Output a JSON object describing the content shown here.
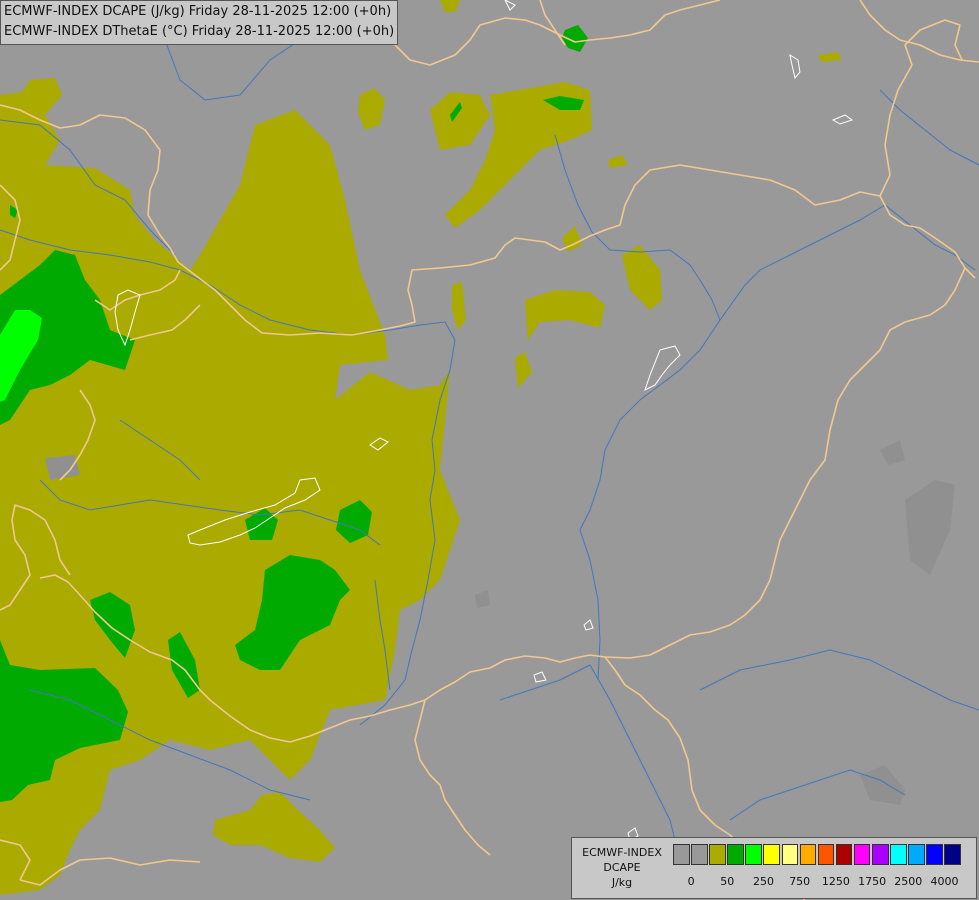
{
  "titles": {
    "line1": "ECMWF-INDEX DCAPE (J/kg) Friday 28-11-2025 12:00 (+0h)",
    "line2": "ECMWF-INDEX DThetaE (°C) Friday 28-11-2025 12:00 (+0h)"
  },
  "legend": {
    "line1": "ECMWF-INDEX",
    "line2": "DCAPE",
    "line3": "J/kg",
    "colors": [
      "#999999",
      "#999999",
      "#aaaa00",
      "#00aa00",
      "#00ff00",
      "#ffff00",
      "#ffff80",
      "#ffaa00",
      "#ff5500",
      "#aa0000",
      "#ff00ff",
      "#aa00ff",
      "#00ffff",
      "#00aaff",
      "#0000ff",
      "#000088"
    ],
    "ticks": [
      "0",
      "50",
      "250",
      "750",
      "1250",
      "1750",
      "2500",
      "4000"
    ]
  },
  "palette": {
    "background": "#999999",
    "olive": "#aaaa00",
    "green": "#00aa00",
    "lime": "#00ff00",
    "borders": "#f0c890",
    "rivers": "#4477bb",
    "lakes": "#ffffff"
  }
}
